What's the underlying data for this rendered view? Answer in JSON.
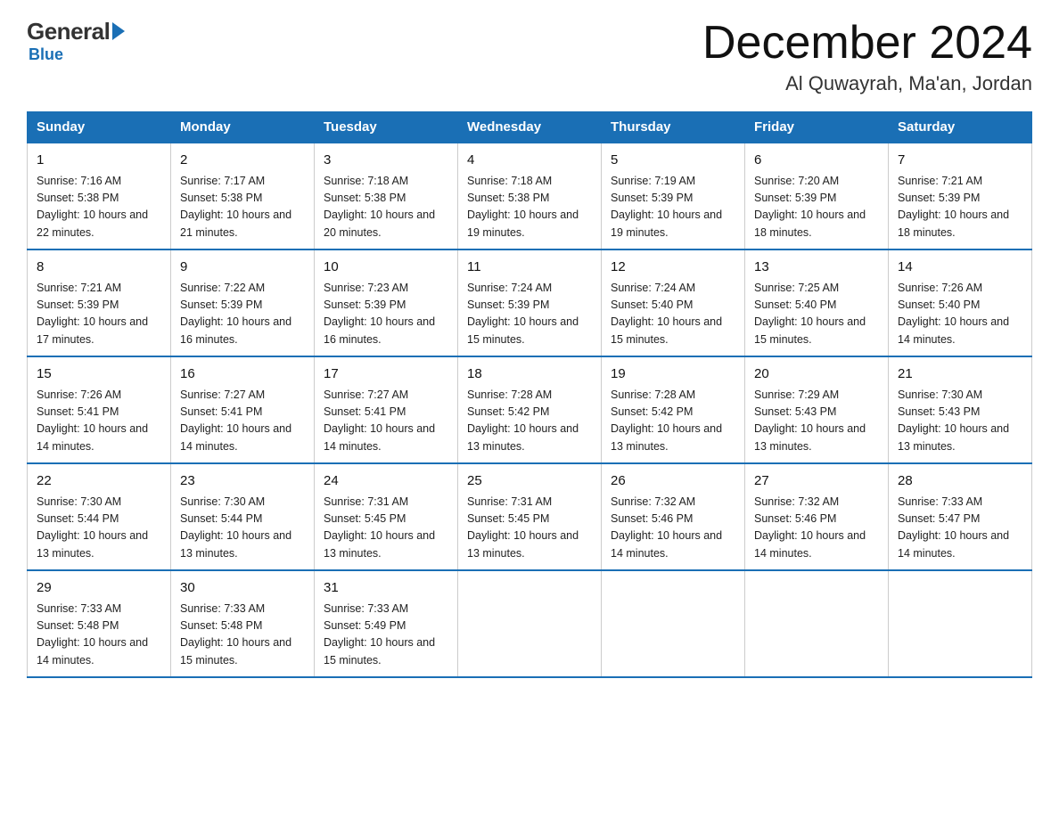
{
  "logo": {
    "general": "General",
    "blue": "Blue"
  },
  "header": {
    "title": "December 2024",
    "subtitle": "Al Quwayrah, Ma'an, Jordan"
  },
  "days_of_week": [
    "Sunday",
    "Monday",
    "Tuesday",
    "Wednesday",
    "Thursday",
    "Friday",
    "Saturday"
  ],
  "weeks": [
    [
      {
        "day": "1",
        "sunrise": "7:16 AM",
        "sunset": "5:38 PM",
        "daylight": "10 hours and 22 minutes."
      },
      {
        "day": "2",
        "sunrise": "7:17 AM",
        "sunset": "5:38 PM",
        "daylight": "10 hours and 21 minutes."
      },
      {
        "day": "3",
        "sunrise": "7:18 AM",
        "sunset": "5:38 PM",
        "daylight": "10 hours and 20 minutes."
      },
      {
        "day": "4",
        "sunrise": "7:18 AM",
        "sunset": "5:38 PM",
        "daylight": "10 hours and 19 minutes."
      },
      {
        "day": "5",
        "sunrise": "7:19 AM",
        "sunset": "5:39 PM",
        "daylight": "10 hours and 19 minutes."
      },
      {
        "day": "6",
        "sunrise": "7:20 AM",
        "sunset": "5:39 PM",
        "daylight": "10 hours and 18 minutes."
      },
      {
        "day": "7",
        "sunrise": "7:21 AM",
        "sunset": "5:39 PM",
        "daylight": "10 hours and 18 minutes."
      }
    ],
    [
      {
        "day": "8",
        "sunrise": "7:21 AM",
        "sunset": "5:39 PM",
        "daylight": "10 hours and 17 minutes."
      },
      {
        "day": "9",
        "sunrise": "7:22 AM",
        "sunset": "5:39 PM",
        "daylight": "10 hours and 16 minutes."
      },
      {
        "day": "10",
        "sunrise": "7:23 AM",
        "sunset": "5:39 PM",
        "daylight": "10 hours and 16 minutes."
      },
      {
        "day": "11",
        "sunrise": "7:24 AM",
        "sunset": "5:39 PM",
        "daylight": "10 hours and 15 minutes."
      },
      {
        "day": "12",
        "sunrise": "7:24 AM",
        "sunset": "5:40 PM",
        "daylight": "10 hours and 15 minutes."
      },
      {
        "day": "13",
        "sunrise": "7:25 AM",
        "sunset": "5:40 PM",
        "daylight": "10 hours and 15 minutes."
      },
      {
        "day": "14",
        "sunrise": "7:26 AM",
        "sunset": "5:40 PM",
        "daylight": "10 hours and 14 minutes."
      }
    ],
    [
      {
        "day": "15",
        "sunrise": "7:26 AM",
        "sunset": "5:41 PM",
        "daylight": "10 hours and 14 minutes."
      },
      {
        "day": "16",
        "sunrise": "7:27 AM",
        "sunset": "5:41 PM",
        "daylight": "10 hours and 14 minutes."
      },
      {
        "day": "17",
        "sunrise": "7:27 AM",
        "sunset": "5:41 PM",
        "daylight": "10 hours and 14 minutes."
      },
      {
        "day": "18",
        "sunrise": "7:28 AM",
        "sunset": "5:42 PM",
        "daylight": "10 hours and 13 minutes."
      },
      {
        "day": "19",
        "sunrise": "7:28 AM",
        "sunset": "5:42 PM",
        "daylight": "10 hours and 13 minutes."
      },
      {
        "day": "20",
        "sunrise": "7:29 AM",
        "sunset": "5:43 PM",
        "daylight": "10 hours and 13 minutes."
      },
      {
        "day": "21",
        "sunrise": "7:30 AM",
        "sunset": "5:43 PM",
        "daylight": "10 hours and 13 minutes."
      }
    ],
    [
      {
        "day": "22",
        "sunrise": "7:30 AM",
        "sunset": "5:44 PM",
        "daylight": "10 hours and 13 minutes."
      },
      {
        "day": "23",
        "sunrise": "7:30 AM",
        "sunset": "5:44 PM",
        "daylight": "10 hours and 13 minutes."
      },
      {
        "day": "24",
        "sunrise": "7:31 AM",
        "sunset": "5:45 PM",
        "daylight": "10 hours and 13 minutes."
      },
      {
        "day": "25",
        "sunrise": "7:31 AM",
        "sunset": "5:45 PM",
        "daylight": "10 hours and 13 minutes."
      },
      {
        "day": "26",
        "sunrise": "7:32 AM",
        "sunset": "5:46 PM",
        "daylight": "10 hours and 14 minutes."
      },
      {
        "day": "27",
        "sunrise": "7:32 AM",
        "sunset": "5:46 PM",
        "daylight": "10 hours and 14 minutes."
      },
      {
        "day": "28",
        "sunrise": "7:33 AM",
        "sunset": "5:47 PM",
        "daylight": "10 hours and 14 minutes."
      }
    ],
    [
      {
        "day": "29",
        "sunrise": "7:33 AM",
        "sunset": "5:48 PM",
        "daylight": "10 hours and 14 minutes."
      },
      {
        "day": "30",
        "sunrise": "7:33 AM",
        "sunset": "5:48 PM",
        "daylight": "10 hours and 15 minutes."
      },
      {
        "day": "31",
        "sunrise": "7:33 AM",
        "sunset": "5:49 PM",
        "daylight": "10 hours and 15 minutes."
      },
      null,
      null,
      null,
      null
    ]
  ]
}
